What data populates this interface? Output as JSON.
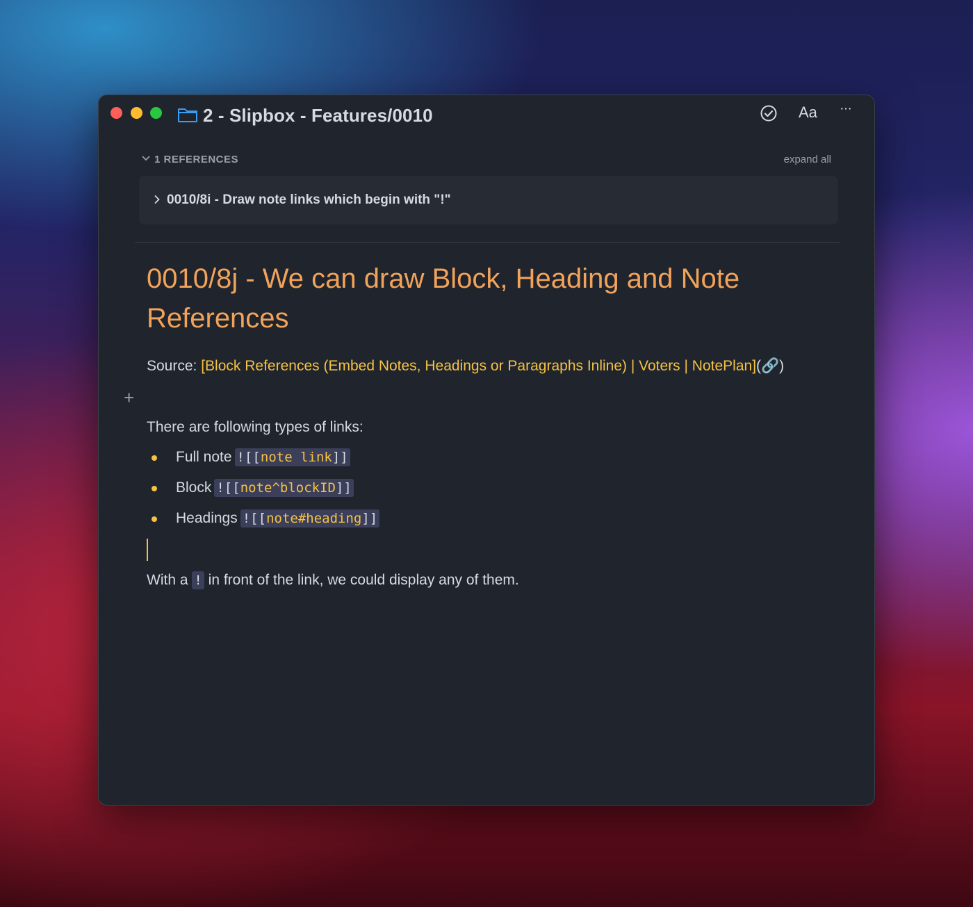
{
  "window": {
    "title": "2 - Slipbox - Features/0010",
    "toolbar": {
      "font_label": "Aa",
      "more_label": "···"
    }
  },
  "references": {
    "header": "1 REFERENCES",
    "expand_all": "expand all",
    "items": [
      {
        "label": "0010/8i - Draw note links which begin with \"!\""
      }
    ]
  },
  "note": {
    "title": "0010/8j - We can draw Block, Heading and Note References",
    "source_prefix": "Source: ",
    "source_link": "[Block References (Embed Notes, Headings or Paragraphs Inline) | Voters | NotePlan]",
    "source_suffix": "(🔗)",
    "plus_label": "+",
    "intro": "There are following types of links:",
    "list": [
      {
        "label": "Full note",
        "code_open": "![[",
        "code_inner": "note link",
        "code_close": "]]"
      },
      {
        "label": "Block",
        "code_open": "![[",
        "code_inner": "note^blockID",
        "code_close": "]]"
      },
      {
        "label": "Headings",
        "code_open": "![[",
        "code_inner": "note#heading",
        "code_close": "]]"
      }
    ],
    "outro_before": "With a ",
    "outro_code": "!",
    "outro_after": " in front of the link, we could display any of them."
  },
  "colors": {
    "accent_title": "#f2a35a",
    "accent_link": "#f5c243",
    "window_bg": "#1f242d",
    "code_bg": "#3c3f5a"
  }
}
